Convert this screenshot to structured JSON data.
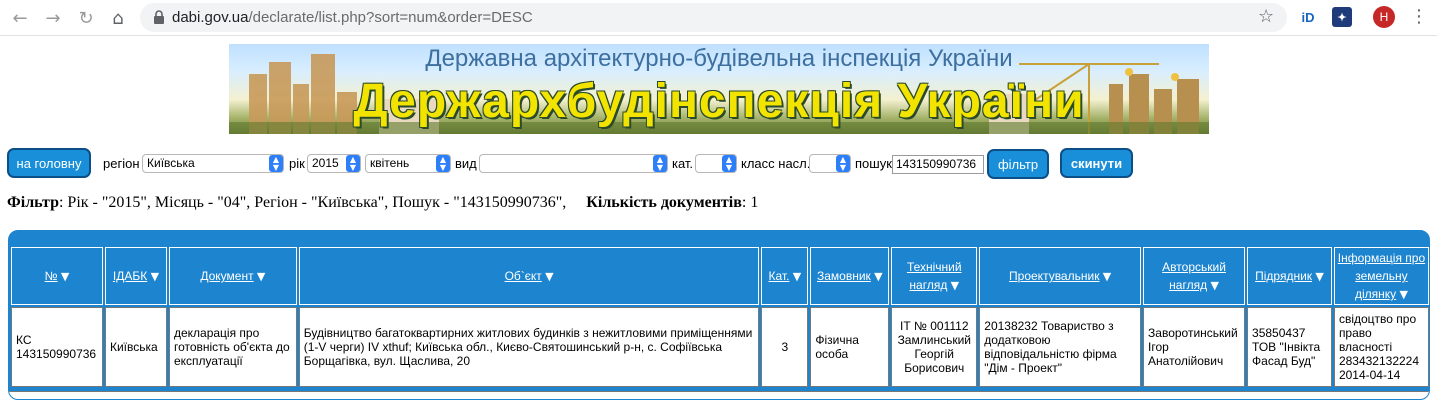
{
  "browser": {
    "url_domain": "dabi.gov.ua",
    "url_path": "/declarate/list.php?sort=num&order=DESC",
    "avatar_letter": "H"
  },
  "banner": {
    "subtitle": "Державна архітектурно-будівельна інспекція України",
    "title": "Держархбудінспекція України"
  },
  "filters": {
    "home_button": "на головну",
    "region_label": "регіон",
    "region_value": "Київська",
    "year_label": "рік",
    "year_value": "2015",
    "month_value": "квітень",
    "type_label": "вид",
    "type_value": "",
    "category_label": "кат.",
    "category_value": "",
    "class_label": "класс насл.",
    "class_value": "",
    "search_label": "пошук",
    "search_value": "143150990736",
    "filter_button": "фільтр",
    "reset_button": "скинути"
  },
  "filter_summary": {
    "label": "Фільтр",
    "text": ": Рік - \"2015\", Місяць - \"04\", Регіон - \"Київська\", Пошук - \"143150990736\",",
    "count_label": "Кількість документів",
    "count_value": ": 1"
  },
  "table": {
    "headers": [
      "№",
      "ІДАБК",
      "Документ",
      "Об`єкт",
      "Кат.",
      "Замовник",
      "Технічний нагляд",
      "Проектувальник",
      "Авторський нагляд",
      "Підрядник",
      "Інформація про земельну ділянку"
    ],
    "rows": [
      {
        "num": "КС 143150990736",
        "idabk": "Київська",
        "document": "декларація про готовність об'єкта до експлуатації",
        "object": "Будівництво багатоквартирних житлових будинків з нежитловими приміщеннями (1-V черги) IV xthuf; Київська обл., Києво-Святошинський р-н, с. Софіївська Борщагівка, вул. Щаслива, 20",
        "category": "3",
        "customer": "Фізична особа",
        "tech_supervision": "ІТ № 001112 Замлинський Георгій Борисович",
        "designer": "20138232 Товариство з додатковою відповідальністю фірма \"Дім - Проект\"",
        "author_supervision": "Заворотинський Ігор Анатолійович",
        "contractor": "35850437 ТОВ \"Інвікта Фасад Буд\"",
        "land_info": "свідоцтво про право власності 283432132224 2014-04-14"
      }
    ]
  }
}
